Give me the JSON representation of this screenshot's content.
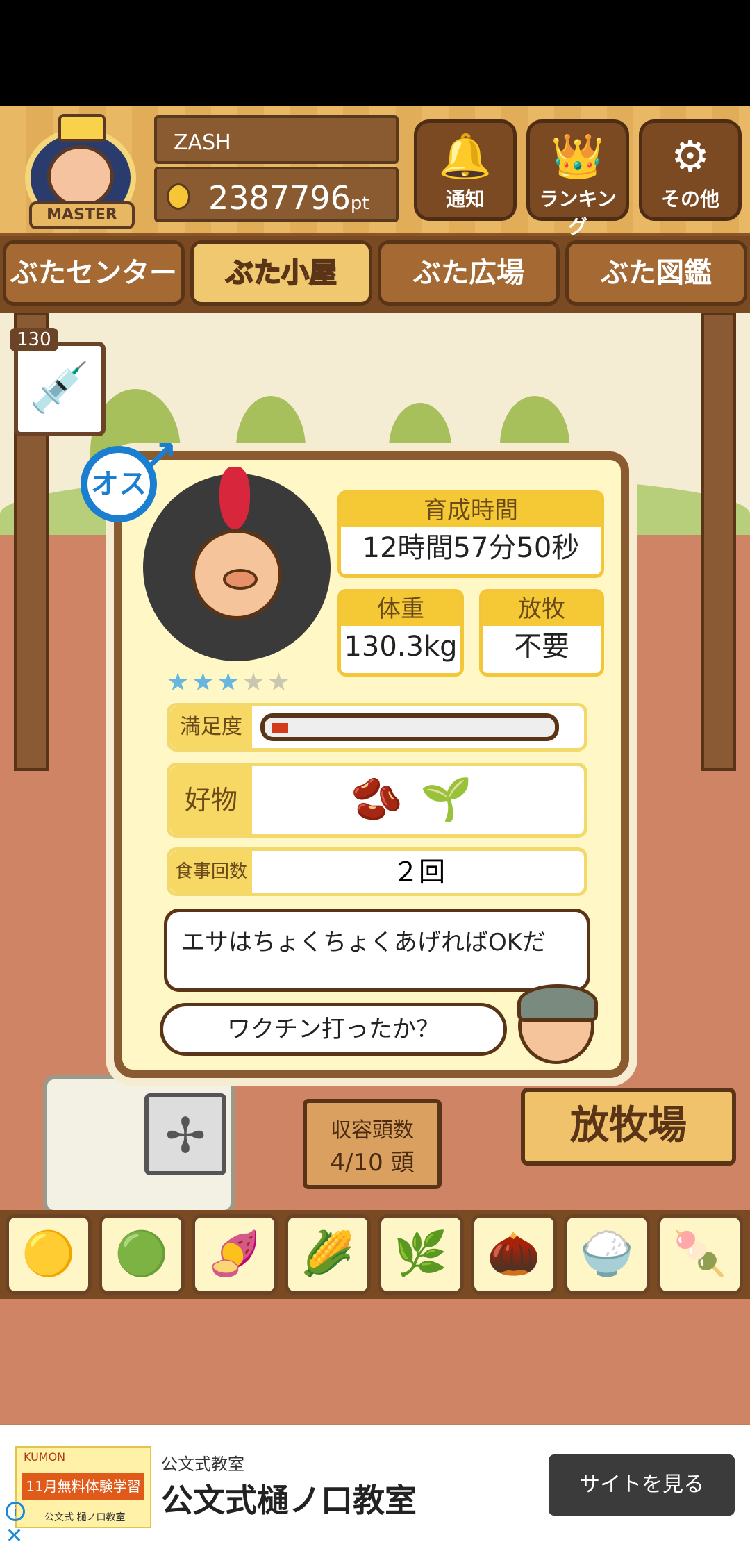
{
  "player": {
    "rank_label": "MASTER",
    "name": "ZASH",
    "points": "2387796",
    "points_unit": "pt"
  },
  "header_buttons": [
    {
      "label": "通知",
      "icon": "bell-icon",
      "glyph": "🔔"
    },
    {
      "label": "ランキング",
      "icon": "crown-icon",
      "glyph": "👑"
    },
    {
      "label": "その他",
      "icon": "gear-icon",
      "glyph": "⚙"
    }
  ],
  "tabs": [
    {
      "label": "ぶたセンター",
      "active": false
    },
    {
      "label": "ぶた小屋",
      "active": true
    },
    {
      "label": "ぶた広場",
      "active": false
    },
    {
      "label": "ぶた図鑑",
      "active": false
    }
  ],
  "vaccine": {
    "count": "130",
    "icon": "syringe-icon",
    "glyph": "💉"
  },
  "pig": {
    "gender_label": "オス",
    "gender_icon": "male-icon",
    "stars_filled": 3,
    "stars_total": 5,
    "stars_text_on": "★★★",
    "stars_text_off": "★★"
  },
  "stats": {
    "raising_time_label": "育成時間",
    "raising_time": "12時間57分50秒",
    "weight_label": "体重",
    "weight": "130.3kg",
    "grazing_label": "放牧",
    "grazing": "不要"
  },
  "satisfaction": {
    "label": "満足度",
    "level": 0.06
  },
  "favorite": {
    "label": "好物",
    "foods": [
      "beans-icon",
      "soybean-plant-icon"
    ],
    "glyphs": [
      "🫘",
      "🌱"
    ]
  },
  "meals": {
    "label": "食事回数",
    "value": "２回"
  },
  "dialog": {
    "hint": "エサはちょくちょくあげればOKだ",
    "question": "ワクチン打ったか？"
  },
  "stage": {
    "capacity_label": "収容頭数",
    "capacity_value": "4/10 頭",
    "pasture_sign": "放牧場"
  },
  "food_bar": [
    {
      "icon": "grain-pile-icon",
      "glyph": "🟡"
    },
    {
      "icon": "mixed-grain-icon",
      "glyph": "🟢"
    },
    {
      "icon": "sweet-potato-icon",
      "glyph": "🍠"
    },
    {
      "icon": "corn-icon",
      "glyph": "🌽"
    },
    {
      "icon": "soybean-plant-icon",
      "glyph": "🌿"
    },
    {
      "icon": "acorn-icon",
      "glyph": "🌰"
    },
    {
      "icon": "grain-plate-icon",
      "glyph": "🍚"
    },
    {
      "icon": "meatball-plate-icon",
      "glyph": "🍡"
    }
  ],
  "ad": {
    "thumb_brand": "KUMON",
    "thumb_headline": "11月無料体験学習",
    "thumb_footer": "公文式 樋ノ口教室",
    "advertiser": "公文式教室",
    "title": "公文式樋ノ口教室",
    "cta": "サイトを見る",
    "info_glyph": "i",
    "close_glyph": "✕"
  },
  "colors": {
    "wood": "#e8b865",
    "tab_active": "#f0c870",
    "panel_bg": "#fff8c6",
    "accent_yellow": "#f5c836",
    "male_blue": "#1a7fd0",
    "meter_fill": "#d43a1a"
  }
}
